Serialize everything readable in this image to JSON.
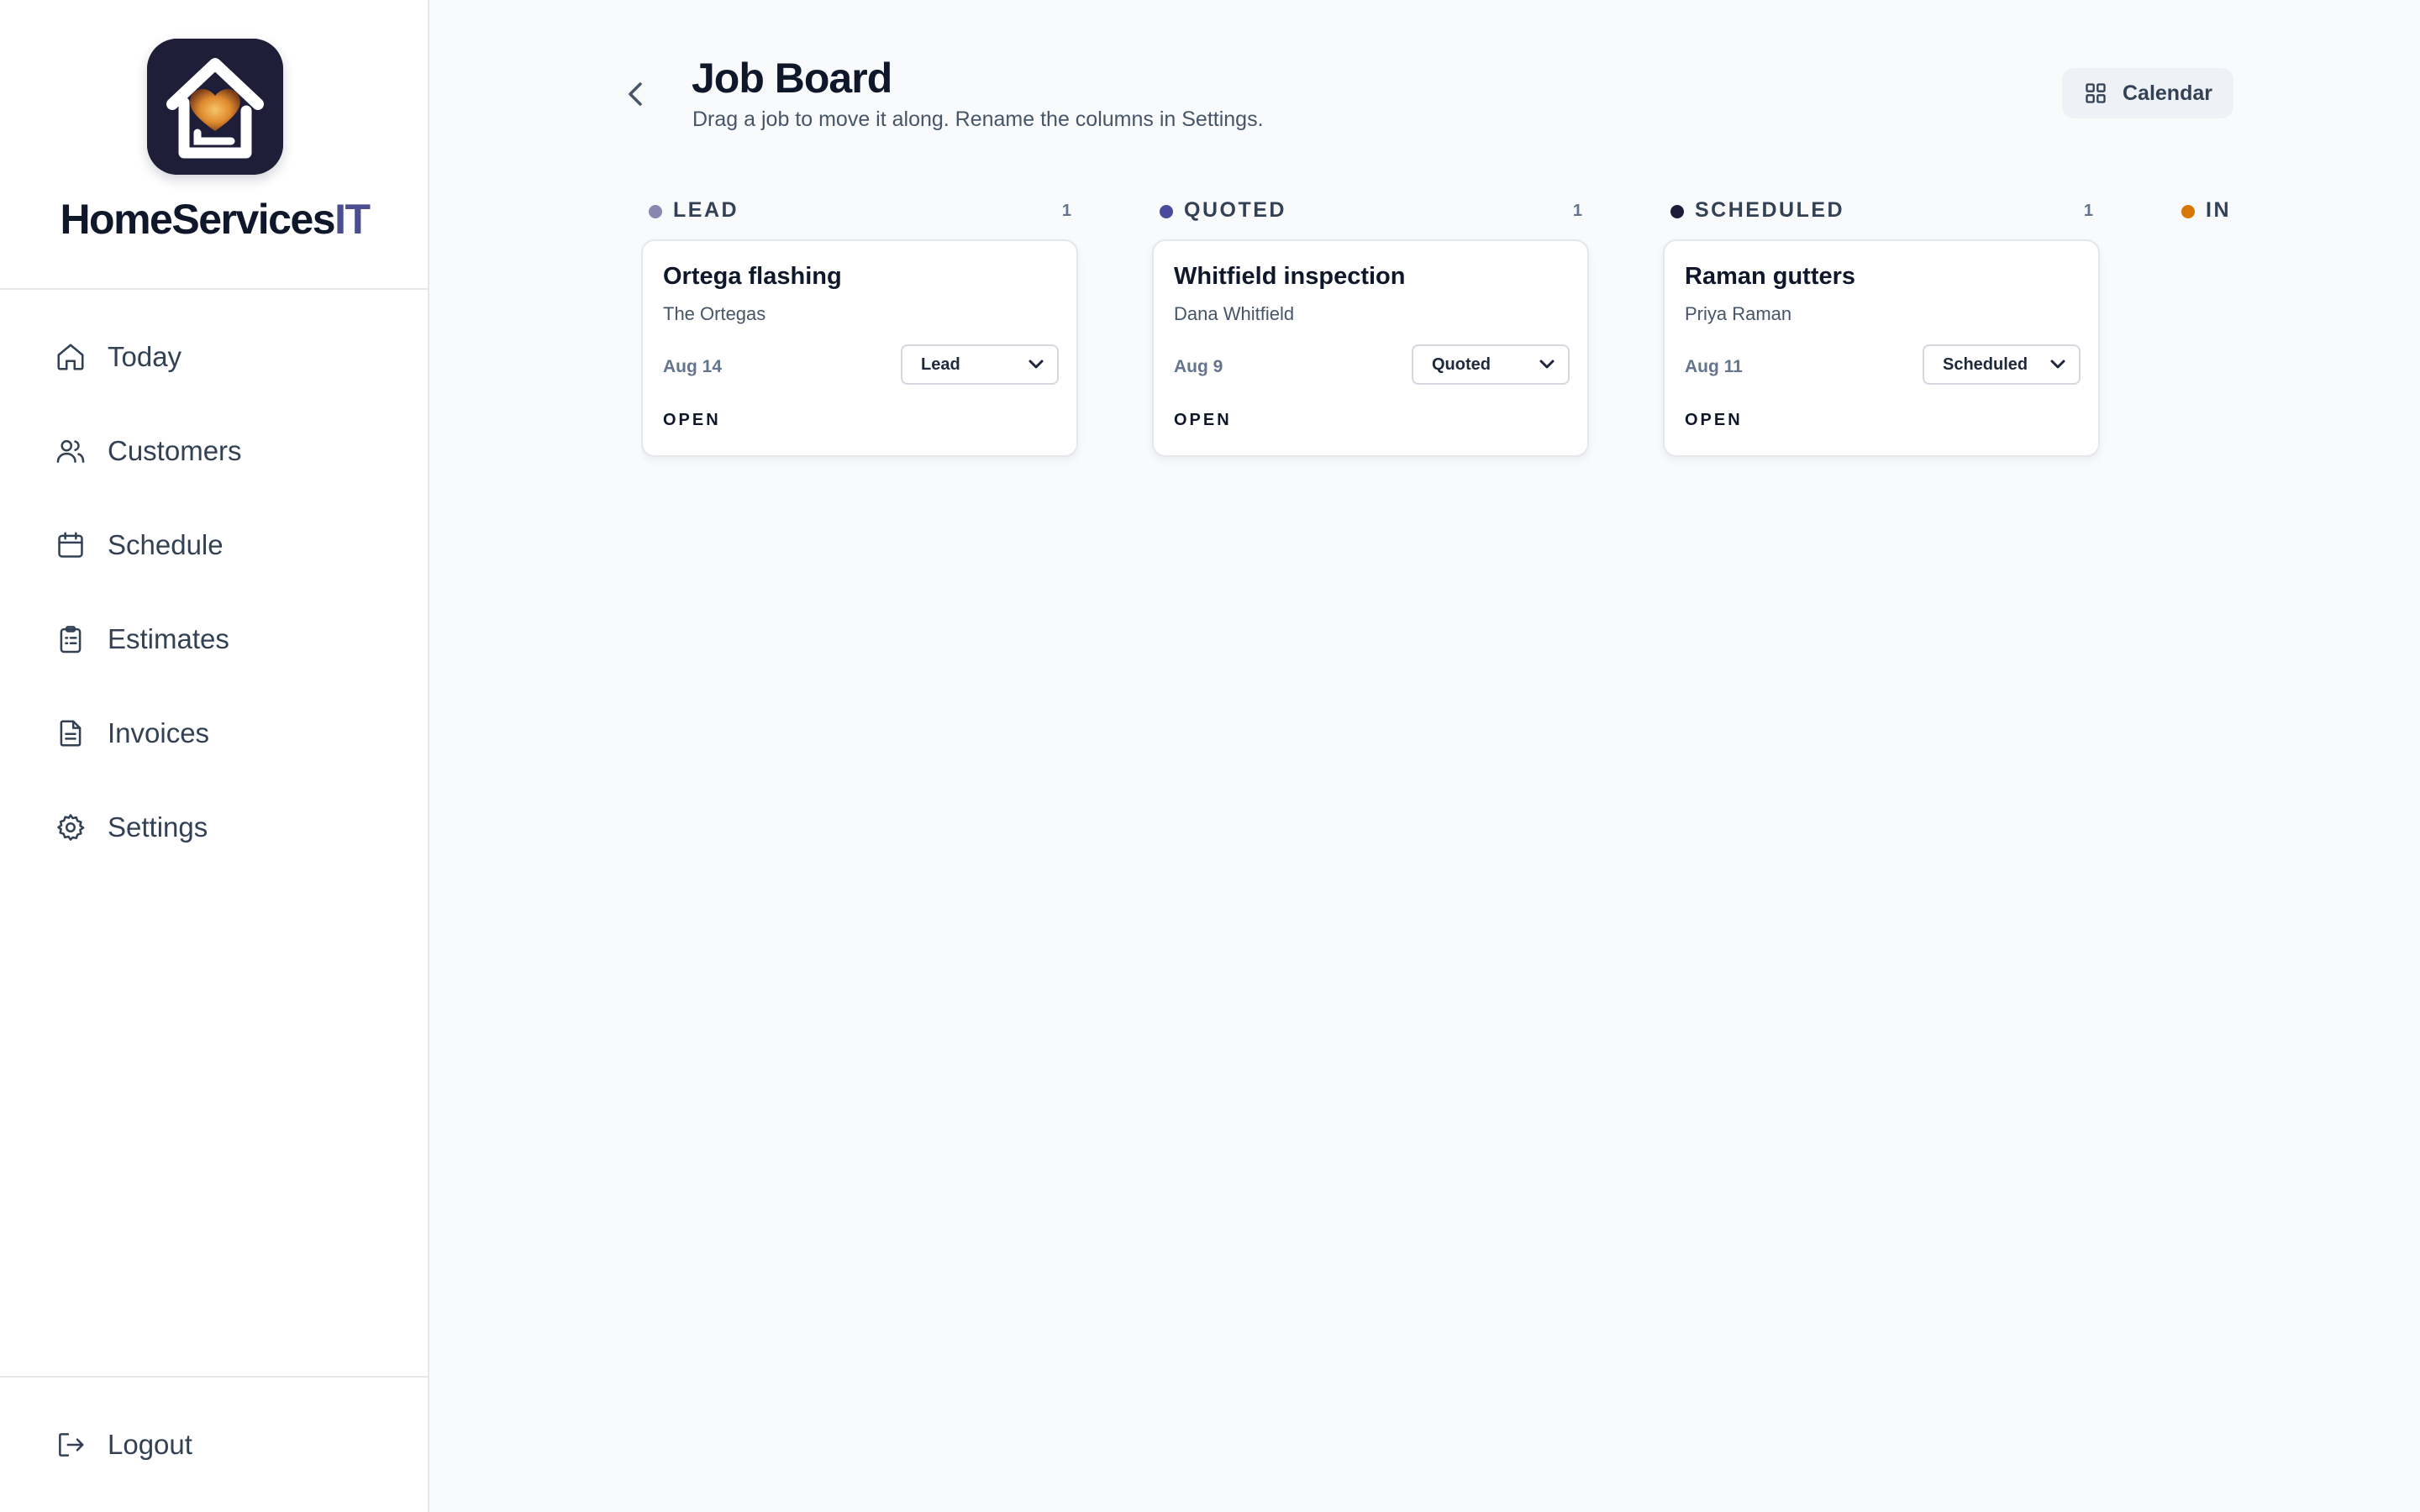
{
  "brand": {
    "name_main": "HomeServices",
    "name_accent": "IT"
  },
  "nav": {
    "items": [
      {
        "label": "Today",
        "icon": "home-icon"
      },
      {
        "label": "Customers",
        "icon": "users-icon"
      },
      {
        "label": "Schedule",
        "icon": "calendar-icon"
      },
      {
        "label": "Estimates",
        "icon": "clipboard-icon"
      },
      {
        "label": "Invoices",
        "icon": "document-icon"
      },
      {
        "label": "Settings",
        "icon": "gear-icon"
      }
    ],
    "logout": {
      "label": "Logout",
      "icon": "logout-icon"
    }
  },
  "header": {
    "title": "Job Board",
    "subtitle": "Drag a job to move it along. Rename the columns in Settings.",
    "calendar_button": "Calendar"
  },
  "columns": [
    {
      "title": "LEAD",
      "count": "1",
      "color": "#8b86b0",
      "card": {
        "title": "Ortega flashing",
        "client": "The Ortegas",
        "date": "Aug 14",
        "stage": "Lead",
        "status": "OPEN"
      }
    },
    {
      "title": "QUOTED",
      "count": "1",
      "color": "#4a4a9c",
      "card": {
        "title": "Whitfield inspection",
        "client": "Dana Whitfield",
        "date": "Aug 9",
        "stage": "Quoted",
        "status": "OPEN"
      }
    },
    {
      "title": "SCHEDULED",
      "count": "1",
      "color": "#1e1b3a",
      "card": {
        "title": "Raman gutters",
        "client": "Priya Raman",
        "date": "Aug 11",
        "stage": "Scheduled",
        "status": "OPEN"
      }
    },
    {
      "title": "IN",
      "color": "#d97706"
    }
  ],
  "colors": {
    "accent": "#4c4f8f",
    "sidebar_bg": "#ffffff",
    "page_bg": "#f8fafc"
  }
}
